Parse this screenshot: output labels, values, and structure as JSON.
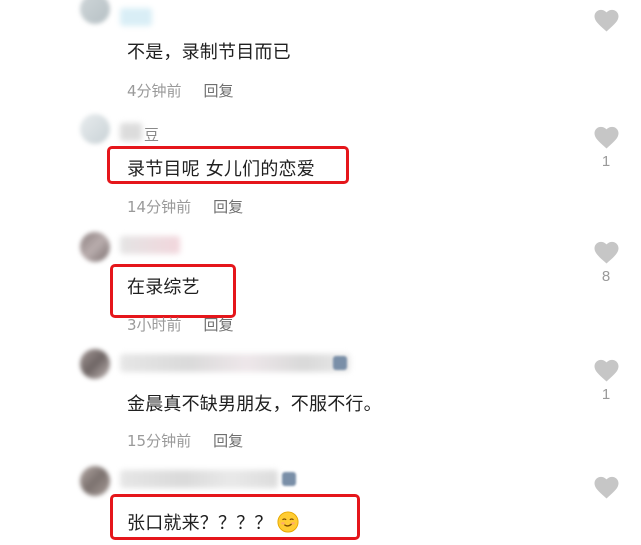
{
  "comments": [
    {
      "username_fragment": "",
      "text": "不是，录制节目而已",
      "time": "4分钟前",
      "reply_label": "回复",
      "likes": ""
    },
    {
      "username_fragment": "豆",
      "text": "录节目呢 女儿们的恋爱",
      "time": "14分钟前",
      "reply_label": "回复",
      "likes": "1"
    },
    {
      "username_fragment": "",
      "text": "在录综艺",
      "time": "3小时前",
      "reply_label": "回复",
      "likes": "8"
    },
    {
      "username_fragment": "",
      "text": "金晨真不缺男朋友，不服不行。",
      "time": "15分钟前",
      "reply_label": "回复",
      "likes": "1"
    },
    {
      "username_fragment": "",
      "text": "张口就来？？？？",
      "time": "",
      "reply_label": "",
      "likes": ""
    }
  ],
  "icons": {
    "like": "heart-icon",
    "emoji": "smirk-face-icon"
  },
  "colors": {
    "highlight_box": "#e5161b",
    "heart": "#c6c6c6"
  }
}
